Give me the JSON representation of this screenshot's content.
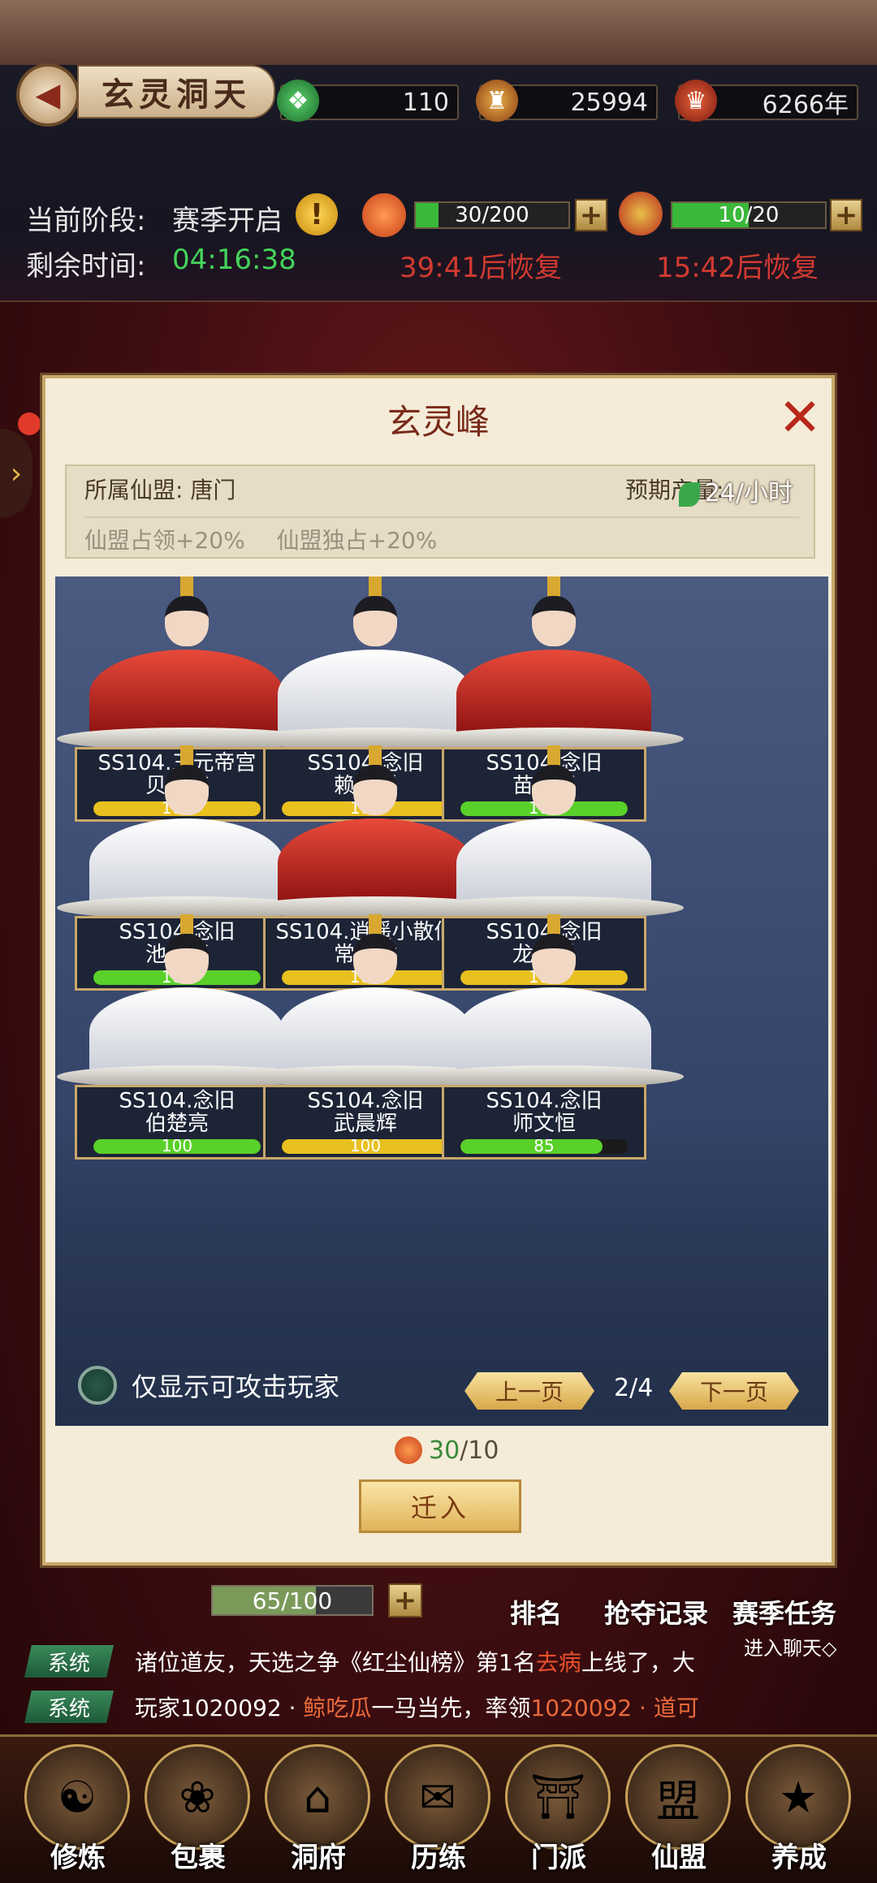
{
  "header": {
    "title": "玄灵洞天",
    "resources": [
      {
        "icon": "jade-icon",
        "value": "110"
      },
      {
        "icon": "gold-token-icon",
        "value": "25994"
      },
      {
        "icon": "lifespan-icon",
        "value": "6266年"
      }
    ],
    "stage_label": "当前阶段:",
    "stage_value": "赛季开启",
    "time_label": "剩余时间:",
    "time_value": "04:16:38",
    "energy1": {
      "value": "30/200",
      "fraction": 0.15,
      "recover": "39:41后恢复"
    },
    "energy2": {
      "value": "10/20",
      "fraction": 0.5,
      "recover": "15:42后恢复"
    }
  },
  "modal": {
    "title": "玄灵峰",
    "alliance_label": "所属仙盟:",
    "alliance_value": "唐门",
    "production_label": "预期产量:",
    "production_value": "24/小时",
    "bonus1": "仙盟占领+20%",
    "bonus2": "仙盟独占+20%",
    "players": [
      {
        "server": "SS104.三元帝宫",
        "name": "贝俊博",
        "hp": 100,
        "hp_label": "100",
        "robe": "red",
        "bar": "yellow"
      },
      {
        "server": "SS104.念旧",
        "name": "赖文韬",
        "hp": 100,
        "hp_label": "100",
        "robe": "white",
        "bar": "yellow"
      },
      {
        "server": "SS104.念旧",
        "name": "苗思羽",
        "hp": 100,
        "hp_label": "100",
        "robe": "red",
        "bar": "green"
      },
      {
        "server": "SS104.念旧",
        "name": "池浩轩",
        "hp": 100,
        "hp_label": "100",
        "robe": "white",
        "bar": "green"
      },
      {
        "server": "SS104.逍遥小散仙",
        "name": "常浩佑",
        "hp": 100,
        "hp_label": "100",
        "robe": "red",
        "bar": "yellow"
      },
      {
        "server": "SS104.念旧",
        "name": "龙逍遥",
        "hp": 100,
        "hp_label": "100",
        "robe": "white",
        "bar": "yellow"
      },
      {
        "server": "SS104.念旧",
        "name": "伯楚亮",
        "hp": 100,
        "hp_label": "100",
        "robe": "white",
        "bar": "green"
      },
      {
        "server": "SS104.念旧",
        "name": "武晨辉",
        "hp": 100,
        "hp_label": "100",
        "robe": "white",
        "bar": "yellow"
      },
      {
        "server": "SS104.念旧",
        "name": "师文恒",
        "hp": 85,
        "hp_label": "85",
        "robe": "white",
        "bar": "green"
      }
    ],
    "filter_label": "仅显示可攻击玩家",
    "prev_label": "上一页",
    "next_label": "下一页",
    "page": "2/4",
    "cost_current": "30",
    "cost_required": "/10",
    "enter_label": "迁入"
  },
  "lower": {
    "bar_value": "65/100",
    "bar_fraction": 0.65,
    "tab_rank": "排名",
    "tab_record": "抢夺记录",
    "tab_task": "赛季任务",
    "chat_link": "进入聊天◇"
  },
  "chat": [
    {
      "tag": "系统",
      "pre": "诸位道友，天选之争《红尘仙榜》第1名",
      "hl": "去病",
      "post": "上线了，大"
    },
    {
      "tag": "系统",
      "pre": "玩家1020092 · ",
      "hl": "鲸吃瓜",
      "post": "一马当先，率领",
      "post2": "1020092 · 道可"
    }
  ],
  "nav": [
    {
      "label": "修炼",
      "icon": "cultivator-icon"
    },
    {
      "label": "包裹",
      "icon": "bag-icon"
    },
    {
      "label": "洞府",
      "icon": "cave-icon"
    },
    {
      "label": "历练",
      "icon": "scroll-icon"
    },
    {
      "label": "门派",
      "icon": "sect-icon"
    },
    {
      "label": "仙盟",
      "icon": "alliance-icon"
    },
    {
      "label": "养成",
      "icon": "pentagram-icon"
    }
  ],
  "colors": {
    "green": "#44d45a",
    "red": "#d23a30",
    "gold": "#c9a86a"
  }
}
